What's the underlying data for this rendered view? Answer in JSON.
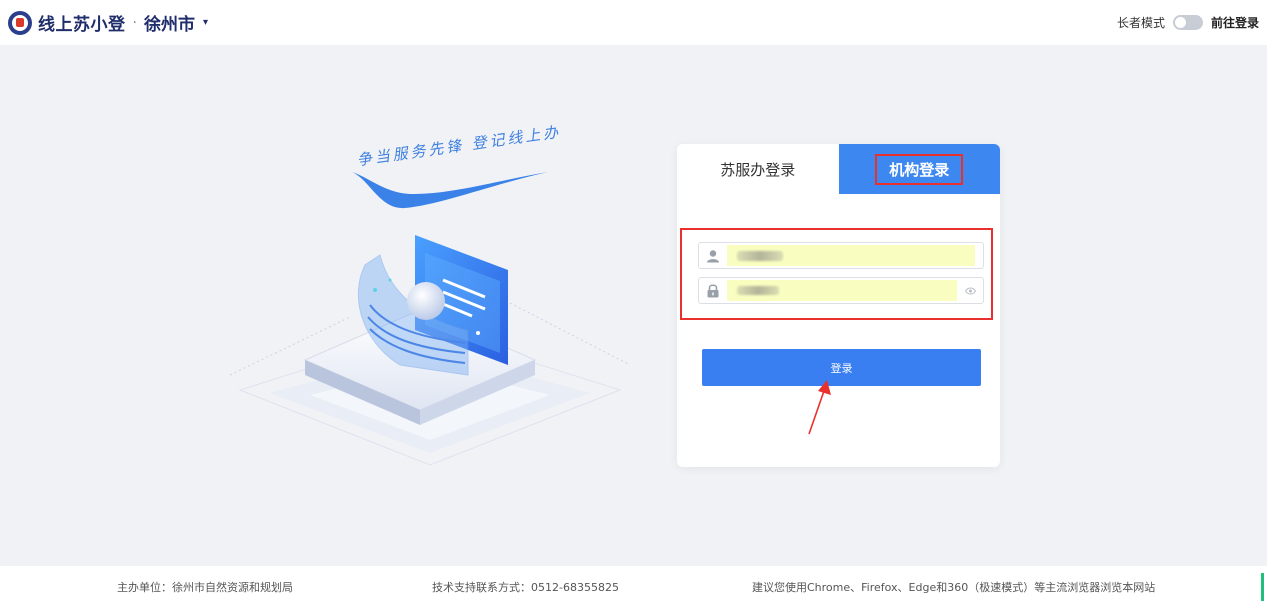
{
  "header": {
    "title": "线上苏小登",
    "separator": "·",
    "city": "徐州市",
    "caret": "▾",
    "elder_mode_label": "长者模式",
    "goto_login": "前往登录"
  },
  "illustration": {
    "slogan": "争当服务先锋 登记线上办"
  },
  "login": {
    "tabs": [
      {
        "label": "苏服办登录",
        "active": false
      },
      {
        "label": "机构登录",
        "active": true
      }
    ],
    "username_icon": "user-icon",
    "password_icon": "lock-icon",
    "submit_label": "登录"
  },
  "footer": {
    "sponsor": "主办单位：徐州市自然资源和规划局",
    "support": "技术支持联系方式：0512-68355825",
    "browser_tip": "建议您使用Chrome、Firefox、Edge和360（极速模式）等主流浏览器浏览本网站"
  },
  "colors": {
    "accent": "#3a7ff2",
    "highlight_border": "#e8312c",
    "autofill_bg": "#fafdc0"
  }
}
